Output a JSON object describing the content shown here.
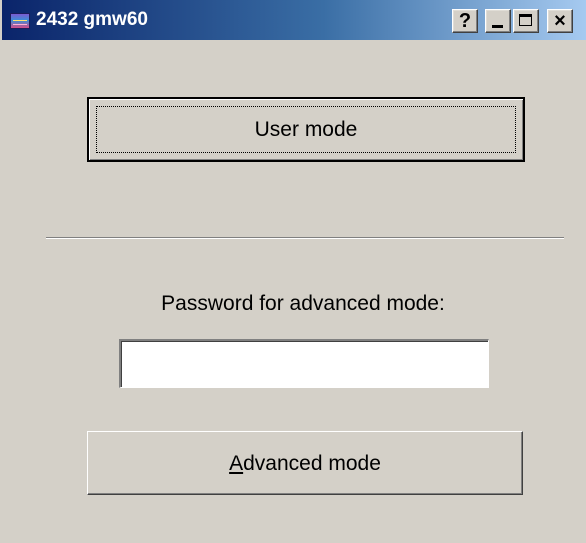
{
  "window": {
    "title": "2432 gmw60",
    "controls": {
      "help": "?",
      "close": "×"
    }
  },
  "dialog": {
    "user_mode_button": "User mode",
    "password_label": "Password for advanced mode:",
    "password_value": "",
    "advanced_mode_button": {
      "mnemonic": "A",
      "rest": "dvanced mode"
    }
  }
}
